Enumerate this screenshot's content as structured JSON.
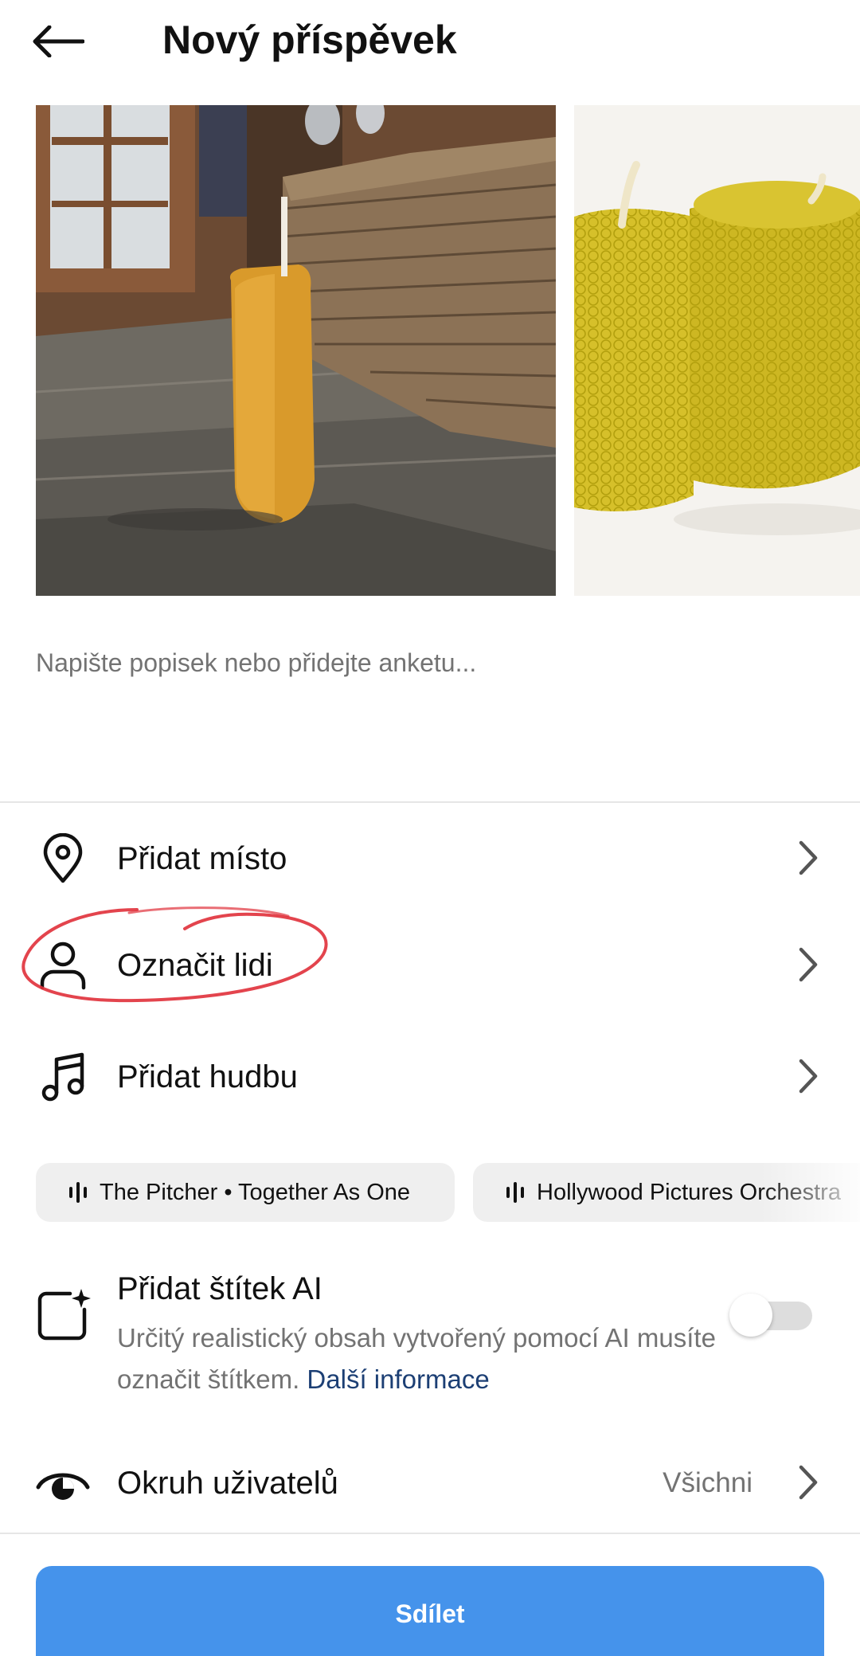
{
  "header": {
    "title": "Nový příspěvek",
    "back_icon": "arrow-left-icon"
  },
  "images": [
    {
      "name": "beeswax-candle-on-table-photo"
    },
    {
      "name": "honeycomb-beeswax-candles-photo"
    }
  ],
  "caption": {
    "placeholder": "Napište popisek nebo přidejte anketu..."
  },
  "menu": {
    "location": {
      "label": "Přidat místo",
      "icon": "location-pin-icon"
    },
    "tag_people": {
      "label": "Označit lidi",
      "icon": "person-icon"
    },
    "music": {
      "label": "Přidat hudbu",
      "icon": "music-note-icon"
    },
    "audience": {
      "label": "Okruh uživatelů",
      "value": "Všichni",
      "icon": "eye-icon"
    }
  },
  "music_suggestions": [
    {
      "label": "The Pitcher • Together As One"
    },
    {
      "label": "Hollywood Pictures Orchestra"
    }
  ],
  "ai_label": {
    "title": "Přidat štítek AI",
    "description": "Určitý realistický obsah vytvořený pomocí AI musíte označit štítkem.",
    "link": "Další informace",
    "enabled": false
  },
  "share_button": {
    "label": "Sdílet"
  },
  "colors": {
    "primary_button": "#4593eb",
    "link": "#1c3f74",
    "annotation": "#e0303a",
    "secondary_text": "#737373"
  }
}
